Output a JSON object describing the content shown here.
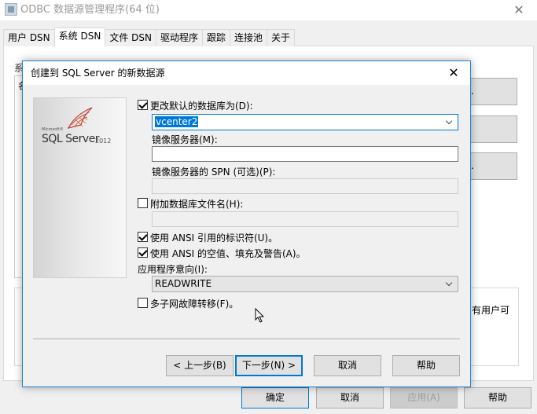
{
  "outer": {
    "title": "ODBC 数据源管理程序(64 位)",
    "close_glyph": "✕",
    "tabs": [
      {
        "label": "用户 DSN",
        "active": false
      },
      {
        "label": "系统 DSN",
        "active": true
      },
      {
        "label": "文件 DSN",
        "active": false
      },
      {
        "label": "驱动程序",
        "active": false
      },
      {
        "label": "跟踪",
        "active": false
      },
      {
        "label": "连接池",
        "active": false
      },
      {
        "label": "关于",
        "active": false
      }
    ],
    "panel_label": "系",
    "list_glyph": "名",
    "side_button_glyph": ".",
    "description_fragment": "有用户可",
    "buttons": {
      "ok": "确定",
      "cancel": "取消",
      "apply": "应用(A)",
      "help": "帮助"
    }
  },
  "dialog": {
    "title": "创建到 SQL Server 的新数据源",
    "close_glyph": "✕",
    "logo": {
      "microsoft": "Microsoft®",
      "product": "SQL Server",
      "version": "2012"
    },
    "change_default_db": {
      "label": "更改默认的数据库为(D):",
      "checked": true
    },
    "database_value": "vcenter2",
    "mirror_server_label": "镜像服务器(M):",
    "mirror_server_value": "",
    "mirror_spn_label": "镜像服务器的 SPN (可选)(P):",
    "mirror_spn_value": "",
    "attach_db": {
      "label": "附加数据库文件名(H):",
      "checked": false
    },
    "attach_db_value": "",
    "ansi_quoted": {
      "label": "使用 ANSI 引用的标识符(U)。",
      "checked": true
    },
    "ansi_nulls": {
      "label": "使用 ANSI 的空值、填充及警告(A)。",
      "checked": true
    },
    "app_intent_label": "应用程序意向(I):",
    "app_intent_value": "READWRITE",
    "multi_subnet": {
      "label": "多子网故障转移(F)。",
      "checked": false
    },
    "buttons": {
      "back": "< 上一步(B)",
      "next": "下一步(N) >",
      "cancel": "取消",
      "help": "帮助"
    }
  },
  "colors": {
    "accent": "#0078d7",
    "dialog_border": "#1883d7",
    "window_bg": "#f0f0f0"
  }
}
